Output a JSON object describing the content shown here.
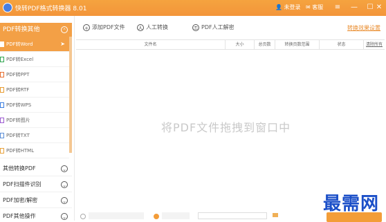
{
  "window": {
    "title": "快转PDF格式转换器 8.01",
    "user_label": "未登录",
    "service_label": "客服",
    "minimize": "—",
    "maximize": "☐",
    "close": "✕"
  },
  "sidebar": {
    "active_group": "PDF转换其他",
    "items": [
      {
        "label": "PDF转Word",
        "icon_color": "#2f6ed6",
        "active": true
      },
      {
        "label": "PDF转Excel",
        "icon_color": "#2ea44f"
      },
      {
        "label": "PDF转PPT",
        "icon_color": "#e66b2c"
      },
      {
        "label": "PDF转RTF",
        "icon_color": "#e89b2f"
      },
      {
        "label": "PDF转WPS",
        "icon_color": "#3b7de0"
      },
      {
        "label": "PDF转图片",
        "icon_color": "#9b59d0"
      },
      {
        "label": "PDF转TXT",
        "icon_color": "#5a8dd6"
      },
      {
        "label": "PDF转HTML",
        "icon_color": "#e8a23b"
      }
    ],
    "groups": [
      "其他转换PDF",
      "PDF扫描件识别",
      "PDF加密/解密",
      "PDF其他操作"
    ]
  },
  "toolbar": {
    "add_pdf": "添加PDF文件",
    "manual_convert": "人工转换",
    "manual_decrypt": "PDF人工解密",
    "convert_settings": "转换效果设置"
  },
  "table": {
    "headers": [
      "文件名",
      "大小",
      "总页数",
      "转换页数范围",
      "状态",
      "清除所有"
    ]
  },
  "main": {
    "drop_hint": "将PDF文件拖拽到窗口中"
  },
  "watermark": "最需网"
}
